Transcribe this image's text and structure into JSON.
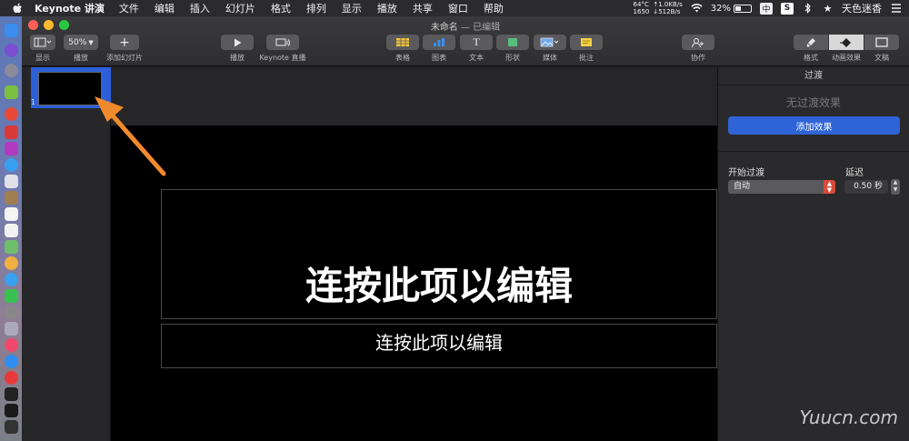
{
  "menubar": {
    "app_name": "Keynote 讲演",
    "items": [
      "文件",
      "编辑",
      "插入",
      "幻灯片",
      "格式",
      "排列",
      "显示",
      "播放",
      "共享",
      "窗口",
      "帮助"
    ],
    "net": {
      "temp": "64°C",
      "fan": "1650",
      "up": "↑1.0KB/s",
      "down": "↓512B/s"
    },
    "battery": "32%",
    "ime": "中",
    "user": "天色迷香"
  },
  "window": {
    "title": "未命名",
    "edited": "— 已编辑"
  },
  "toolbar": {
    "view_label": "显示",
    "zoom_value": "50%",
    "zoom_label": "播放",
    "add_slide_label": "添加幻灯片",
    "play_label": "播放",
    "keynote_live_label": "Keynote 直播",
    "table_label": "表格",
    "chart_label": "图表",
    "text_label": "文本",
    "shape_label": "形状",
    "media_label": "媒体",
    "comment_label": "批注",
    "collab_label": "协作",
    "format_label": "格式",
    "animate_label": "动画效果",
    "document_label": "文稿"
  },
  "navigator": {
    "slide_number": "1"
  },
  "slide": {
    "title_placeholder": "连按此项以编辑",
    "subtitle_placeholder": "连按此项以编辑"
  },
  "inspector": {
    "header": "过渡",
    "no_transition": "无过渡效果",
    "add_effect": "添加效果",
    "start_label": "开始过渡",
    "start_value": "自动",
    "delay_label": "延迟",
    "delay_value": "0.50 秒"
  },
  "watermark": "Yuucn.com",
  "colors": {
    "accent_blue": "#2f64d6",
    "arrow_orange": "#f08a2c"
  }
}
